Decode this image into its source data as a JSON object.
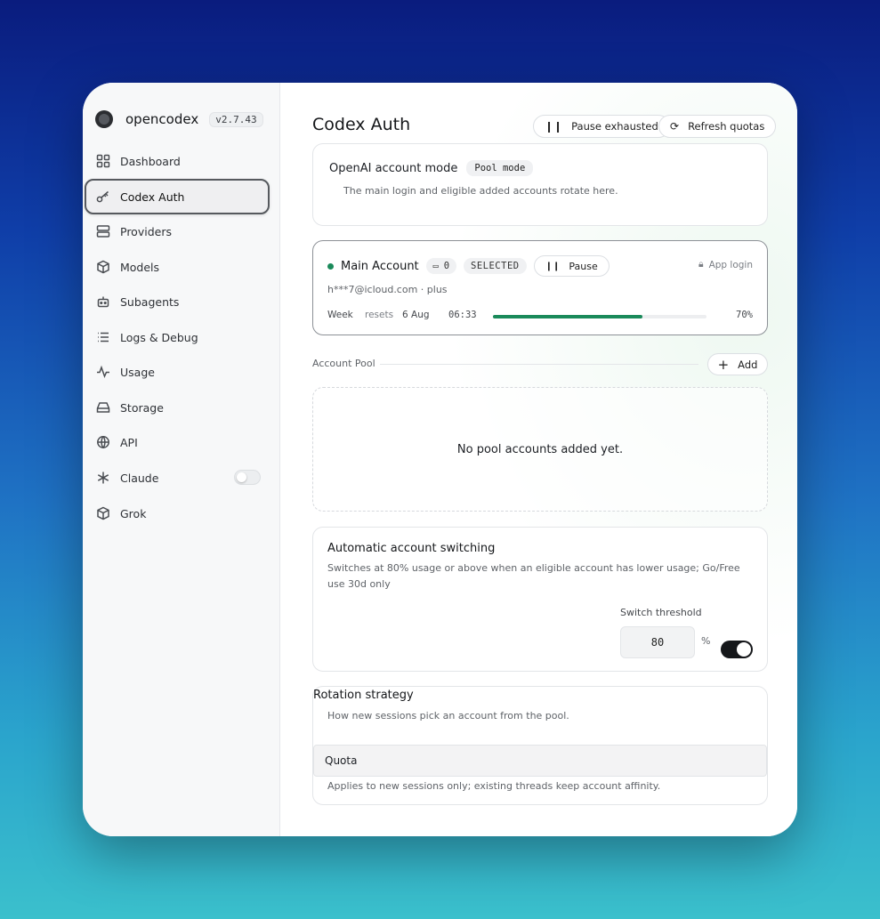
{
  "brand": {
    "name": "opencodex",
    "version": "v2.7.43"
  },
  "sidebar": {
    "items": [
      {
        "label": "Dashboard",
        "icon": "grid-icon"
      },
      {
        "label": "Codex Auth",
        "icon": "key-icon",
        "active": true
      },
      {
        "label": "Providers",
        "icon": "server-icon"
      },
      {
        "label": "Models",
        "icon": "cube-icon"
      },
      {
        "label": "Subagents",
        "icon": "bot-icon"
      },
      {
        "label": "Logs & Debug",
        "icon": "list-icon"
      },
      {
        "label": "Usage",
        "icon": "activity-icon"
      },
      {
        "label": "Storage",
        "icon": "drive-icon"
      },
      {
        "label": "API",
        "icon": "globe-icon"
      },
      {
        "label": "Claude",
        "icon": "asterisk-icon",
        "toggle": false
      },
      {
        "label": "Grok",
        "icon": "cube-icon"
      }
    ]
  },
  "header": {
    "title": "Codex Auth",
    "pause_exhausted_label": "Pause exhausted",
    "refresh_quotas_label": "Refresh quotas"
  },
  "mode_card": {
    "title": "OpenAI account mode",
    "mode_badge": "Pool mode",
    "description": "The main login and eligible added accounts rotate here."
  },
  "main_account": {
    "name": "Main Account",
    "count": "0",
    "status": "SELECTED",
    "pause_label": "Pause",
    "app_login_label": "App login",
    "email": "h***7@icloud.com · plus",
    "quota": {
      "period": "Week",
      "resets_label": "resets",
      "reset_date": "6 Aug",
      "reset_time": "06:33",
      "used_percent": 70,
      "used_label": "70%"
    },
    "status_color": "#1a8a5a"
  },
  "pool": {
    "label": "Account Pool",
    "add_label": "Add",
    "empty_text": "No pool accounts added yet."
  },
  "auto_switch": {
    "title": "Automatic account switching",
    "description": "Switches at 80% usage or above when an eligible account has lower usage; Go/Free use 30d only",
    "threshold_label": "Switch threshold",
    "threshold_value": "80",
    "unit": "%",
    "enabled": true
  },
  "rotation": {
    "title": "Rotation strategy",
    "description": "How new sessions pick an account from the pool.",
    "selected": "Quota",
    "note": "Applies to new sessions only; existing threads keep account affinity."
  }
}
